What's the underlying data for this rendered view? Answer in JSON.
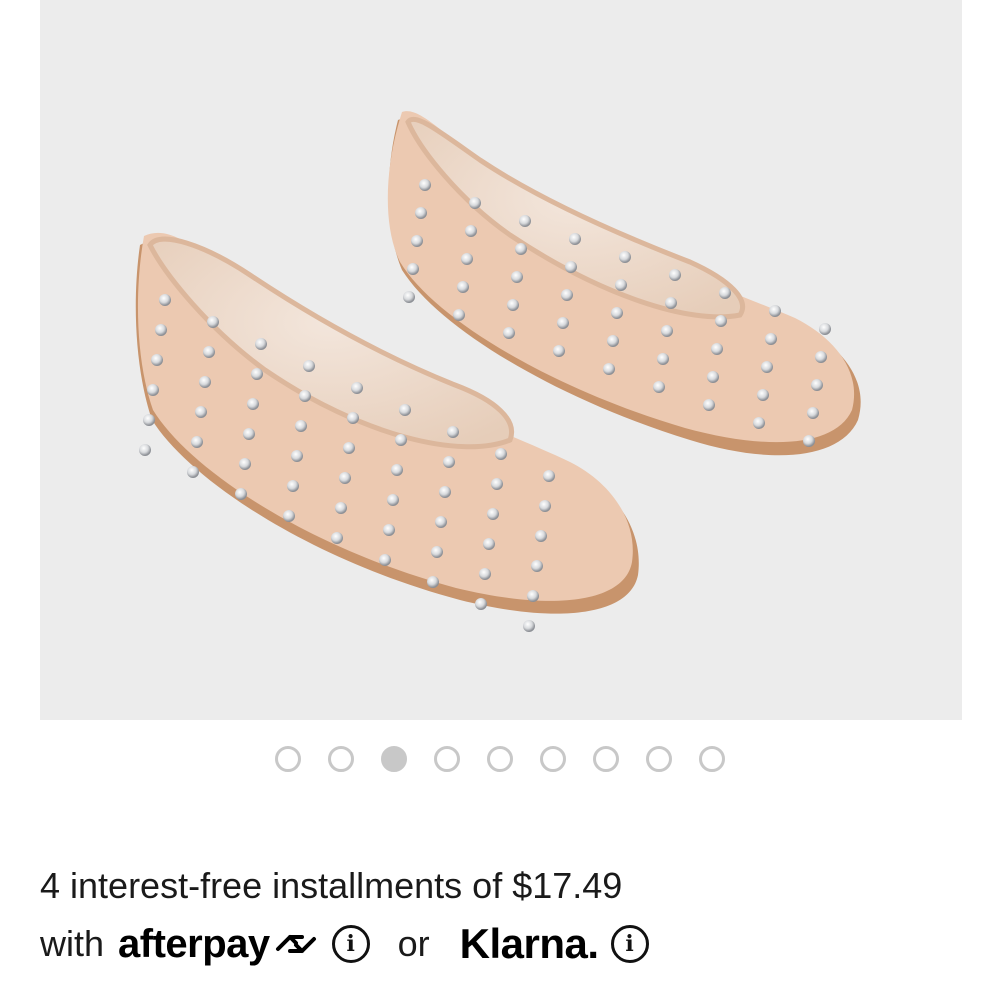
{
  "product_image": {
    "alt": "Beige mesh ballet flats with crystal studs"
  },
  "carousel": {
    "dot_count": 9,
    "active_index": 2
  },
  "payment": {
    "installments_text": "4 interest-free installments of $17.49",
    "with_text": "with",
    "afterpay_label": "afterpay",
    "or_text": "or",
    "klarna_label": "Klarna.",
    "info_glyph": "i"
  },
  "colors": {
    "image_bg": "#ececec",
    "dot_inactive": "#c8c8c8",
    "text": "#1a1a1a"
  }
}
